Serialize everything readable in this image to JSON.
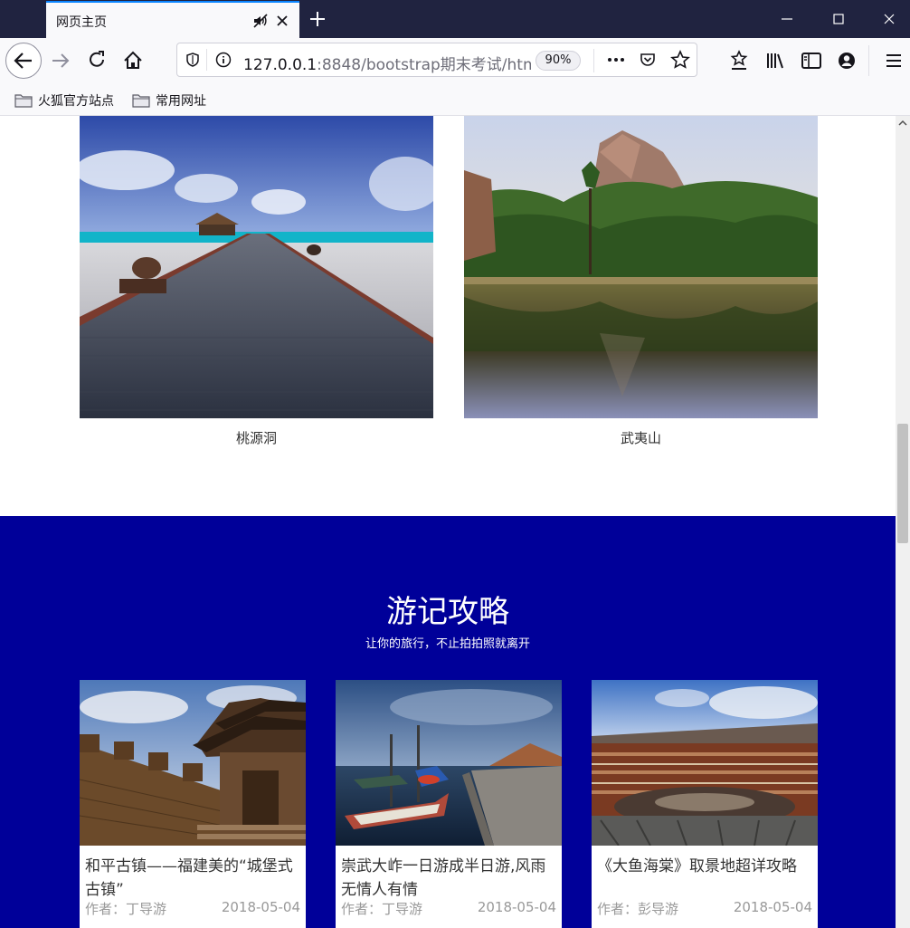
{
  "browser": {
    "tab_title": "网页主页",
    "url_host": "127.0.0.1",
    "url_rest": ":8848/bootstrap期末考试/htm",
    "zoom": "90%",
    "bookmarks": [
      "火狐官方站点",
      "常用网址"
    ]
  },
  "scenic": [
    {
      "caption": "桃源洞"
    },
    {
      "caption": "武夷山"
    }
  ],
  "travel": {
    "title": "游记攻略",
    "subtitle": "让你的旅行，不止拍拍照就离开",
    "cards": [
      {
        "title": "和平古镇——福建美的“城堡式古镇”",
        "author": "作者：丁导游",
        "date": "2018-05-04"
      },
      {
        "title": "崇武大岞一日游成半日游,风雨无情人有情",
        "author": "作者：丁导游",
        "date": "2018-05-04"
      },
      {
        "title": "《大鱼海棠》取景地超详攻略",
        "author": "作者：彭导游",
        "date": "2018-05-04"
      }
    ]
  },
  "colors": {
    "section_bg": "#000099",
    "tab_accent": "#0a84ff",
    "titlebar": "#202340"
  }
}
